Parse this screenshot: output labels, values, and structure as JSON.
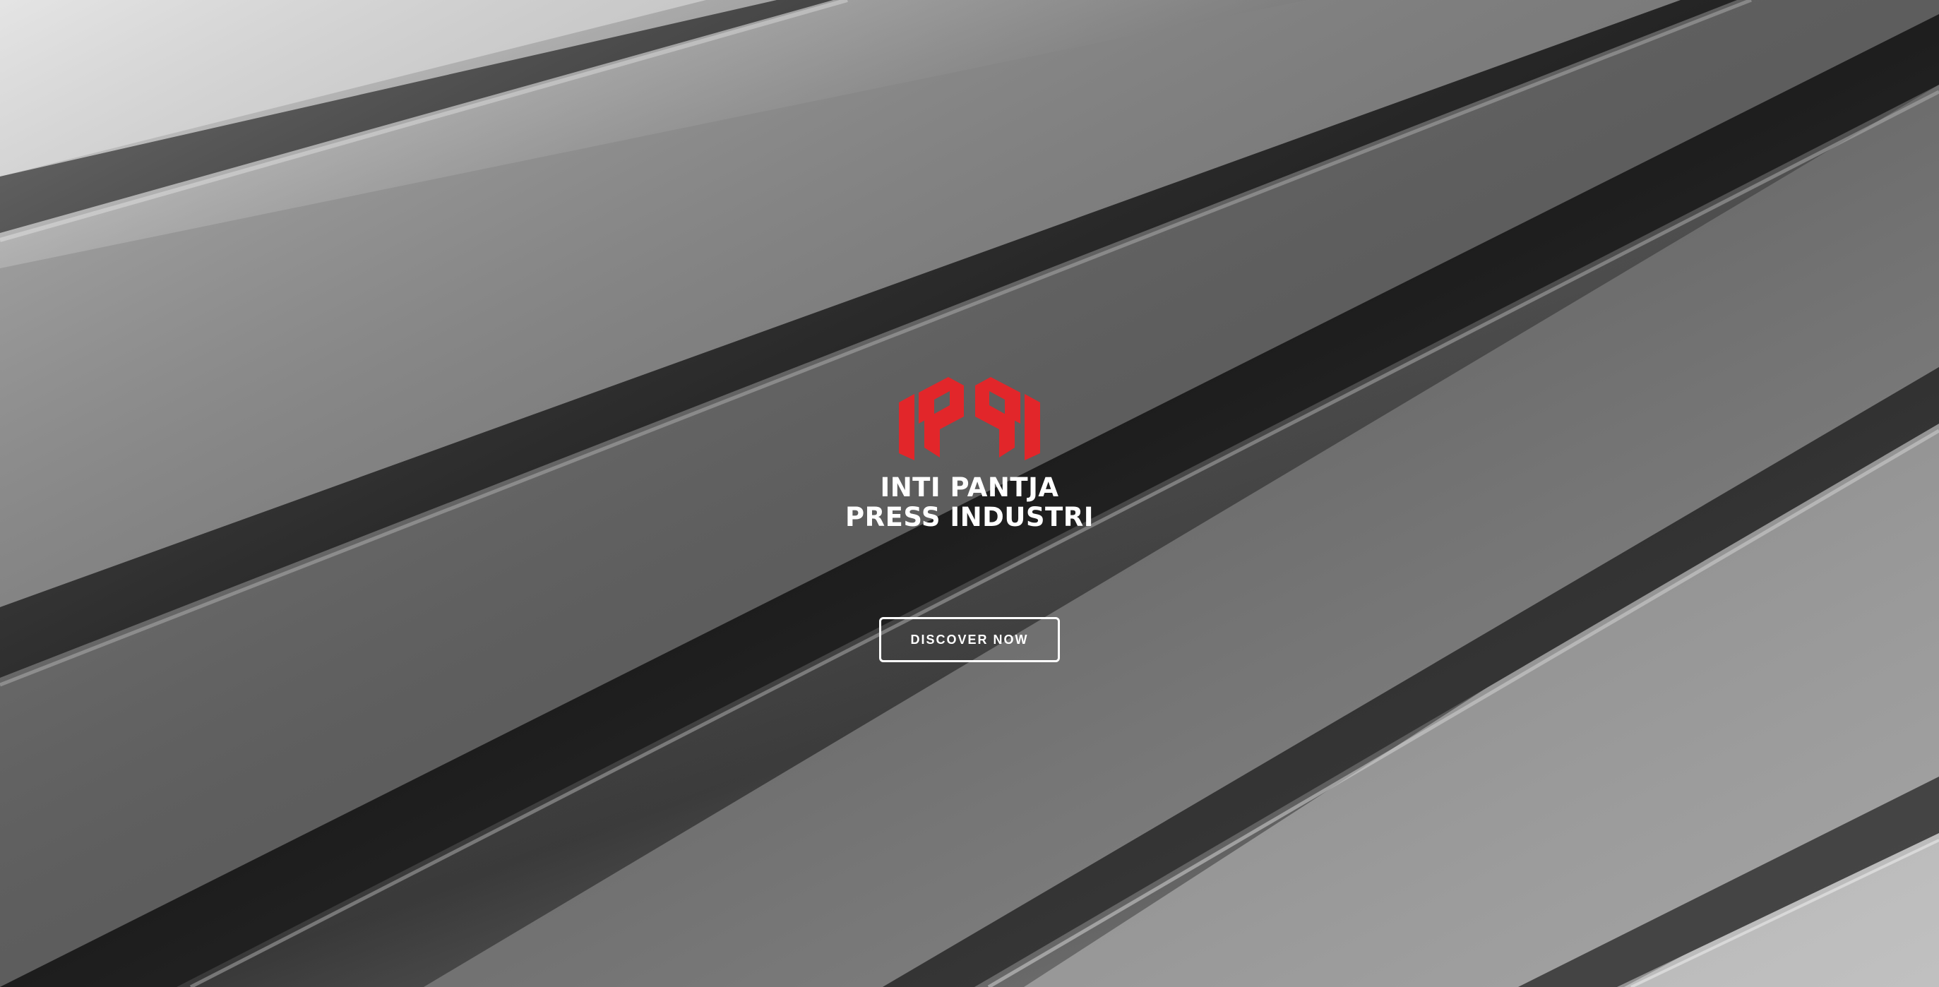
{
  "hero": {
    "brand_line1": "INTI PANTJA",
    "brand_line2": "PRESS INDUSTRI",
    "logo_text": "IPPI",
    "cta_label": "DISCOVER NOW"
  },
  "colors": {
    "logo_red": "#e2262a",
    "text": "#ffffff"
  },
  "icons": {
    "logo": "ippi-logo-icon"
  }
}
